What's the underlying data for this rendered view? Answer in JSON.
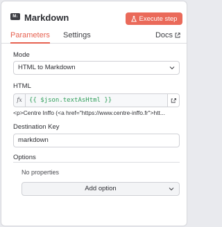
{
  "header": {
    "node_icon_text": "M↓",
    "title": "Markdown",
    "execute_label": "Execute step",
    "accent_color": "#ea6a5a"
  },
  "tabs": {
    "items": [
      {
        "label": "Parameters",
        "active": true
      },
      {
        "label": "Settings",
        "active": false
      }
    ],
    "docs_label": "Docs"
  },
  "form": {
    "mode_label": "Mode",
    "mode_value": "HTML to Markdown",
    "html_label": "HTML",
    "html_expression_prefix": "fx",
    "html_expression": "{{ $json.textAsHtml }}",
    "html_preview": "<p>Centre Inffo (<a href=\"https://www.centre-inffo.fr\">htt...",
    "destination_key_label": "Destination Key",
    "destination_key_value": "markdown",
    "options_label": "Options",
    "no_properties_text": "No properties",
    "add_option_label": "Add option"
  }
}
